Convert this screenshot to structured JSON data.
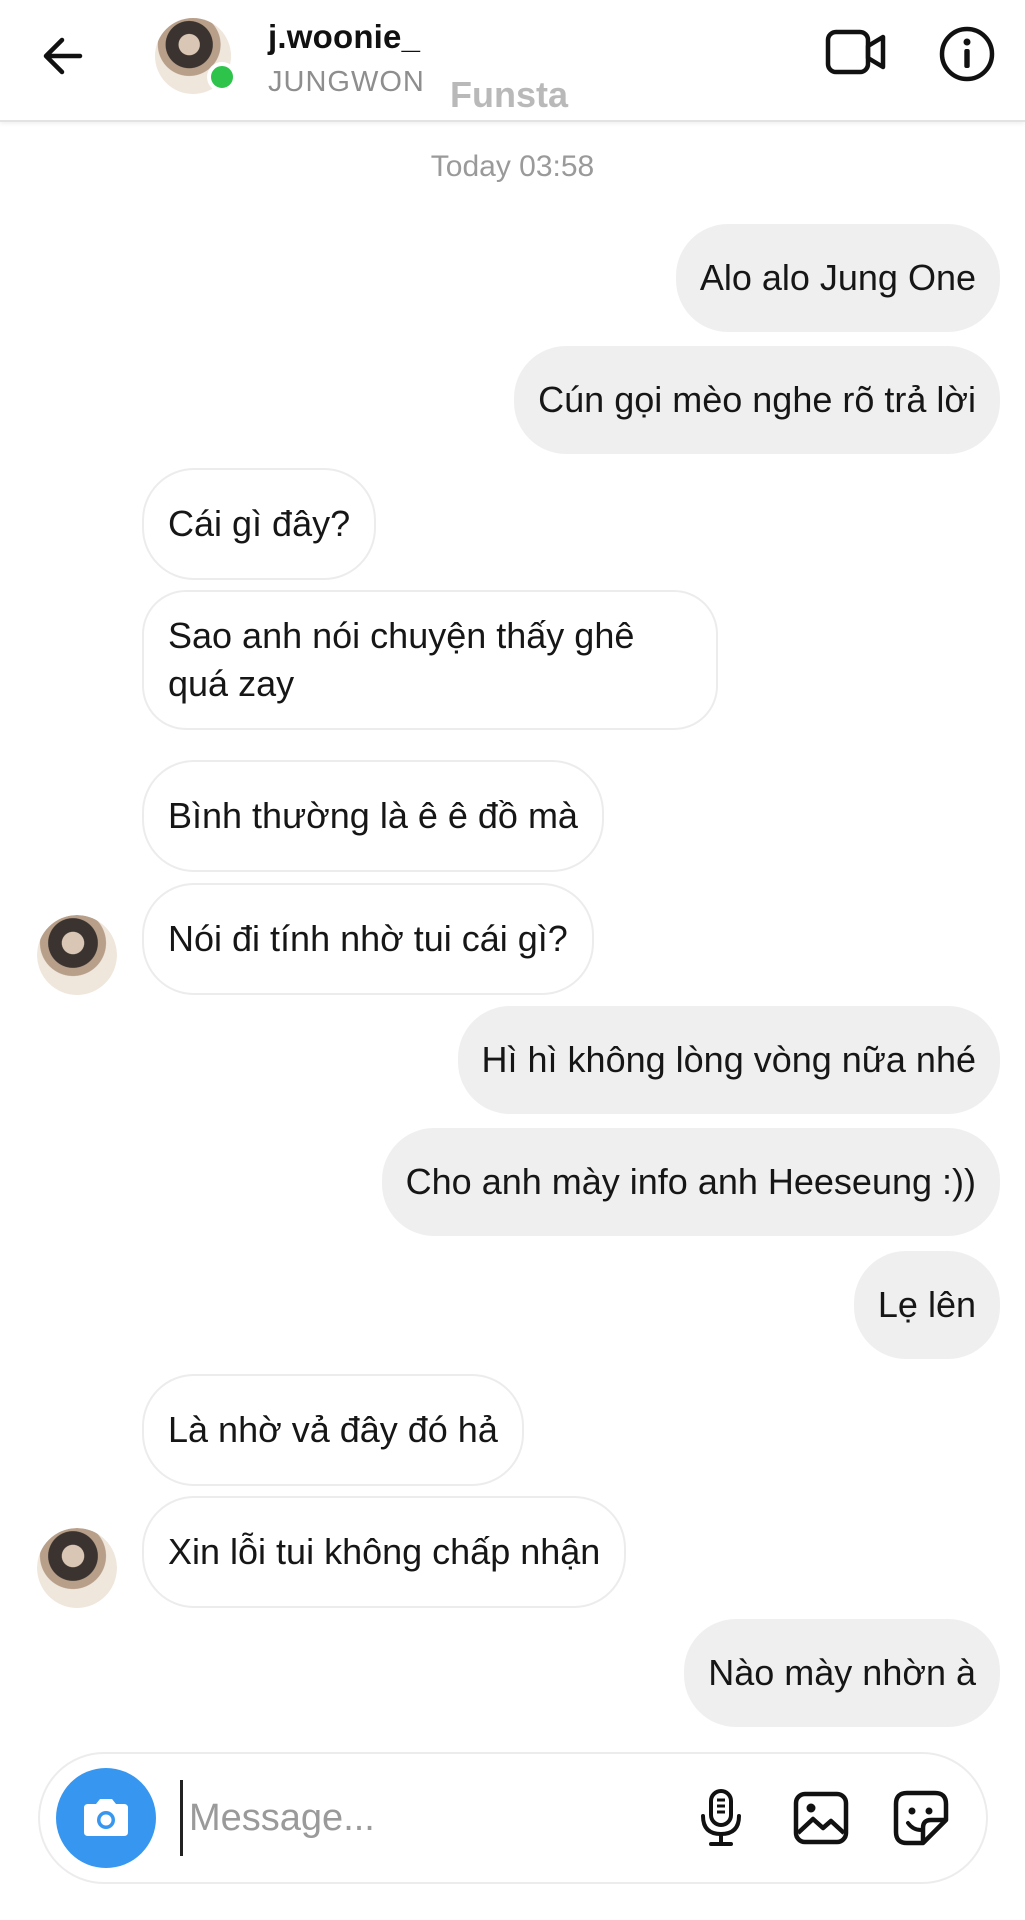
{
  "header": {
    "username": "j.woonie_",
    "subtitle": "JUNGWON",
    "tag": "Funsta",
    "online_color": "#2ec44b",
    "icons": {
      "back": "arrow-left-icon",
      "video": "video-camera-icon",
      "info": "info-icon"
    }
  },
  "conversation": {
    "timestamp": "Today 03:58",
    "messages": [
      {
        "from": "me",
        "text": "Alo alo Jung One"
      },
      {
        "from": "me",
        "text": "Cún gọi mèo nghe rõ trả lời"
      },
      {
        "from": "them",
        "text": "Cái gì đây?"
      },
      {
        "from": "them",
        "text": "Sao anh nói chuyện thấy ghê quá zay"
      },
      {
        "from": "them",
        "text": "Bình thường là ê ê đồ mà"
      },
      {
        "from": "them",
        "text": "Nói đi tính nhờ tui cái gì?"
      },
      {
        "from": "me",
        "text": "Hì hì không lòng vòng nữa nhé"
      },
      {
        "from": "me",
        "text": "Cho anh mày info anh Heeseung :))"
      },
      {
        "from": "me",
        "text": "Lẹ lên"
      },
      {
        "from": "them",
        "text": "Là nhờ vả đây đó hả"
      },
      {
        "from": "them",
        "text": "Xin lỗi tui không chấp nhận"
      },
      {
        "from": "me",
        "text": "Nào mày nhờn à"
      }
    ]
  },
  "composer": {
    "placeholder": "Message...",
    "value": "",
    "accent_color": "#3797f0",
    "icons": {
      "camera": "camera-icon",
      "mic": "microphone-icon",
      "gallery": "image-icon",
      "sticker": "sticker-icon"
    }
  }
}
